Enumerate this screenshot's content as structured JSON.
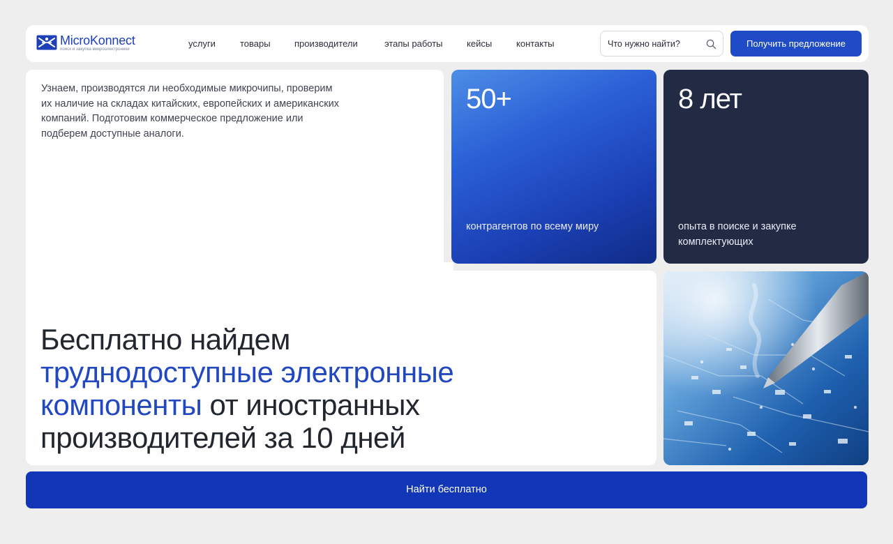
{
  "header": {
    "logo": {
      "name": "MicroKonnect",
      "tagline": "поиск и закупка микроэлектроники"
    },
    "nav": [
      {
        "label": "услуги"
      },
      {
        "label": "товары"
      },
      {
        "label": "производители"
      },
      {
        "label": "этапы работы"
      },
      {
        "label": "кейсы"
      },
      {
        "label": "контакты"
      }
    ],
    "search": {
      "placeholder": "Что нужно найти?",
      "value": ""
    },
    "cta_label": "Получить предложение"
  },
  "hero": {
    "intro": "Узнаем, производятся ли необходимые микрочипы, проверим их наличие на складах китайских, европейских и американских компаний. Подготовим коммерческое предложение или подберем доступные аналоги.",
    "headline": {
      "part1": "Бесплатно найдем",
      "accent": "труднодоступные электронные компоненты",
      "part2": "от иностранных производителей за 10 дней"
    }
  },
  "stats": [
    {
      "value": "50+",
      "caption": "контрагентов по всему миру"
    },
    {
      "value": "8 лет",
      "caption": "опыта в поиске и закупке комплектующих"
    }
  ],
  "bottom_cta": {
    "label": "Найти бесплатно"
  },
  "colors": {
    "accent": "#1f4cc6",
    "cta_bottom": "#1137b8",
    "dark_card": "#232a44",
    "headline_accent": "#2147c1",
    "background": "#eeeeef"
  },
  "icons": {
    "logo": "microchip-logo-icon",
    "search": "search-icon"
  }
}
